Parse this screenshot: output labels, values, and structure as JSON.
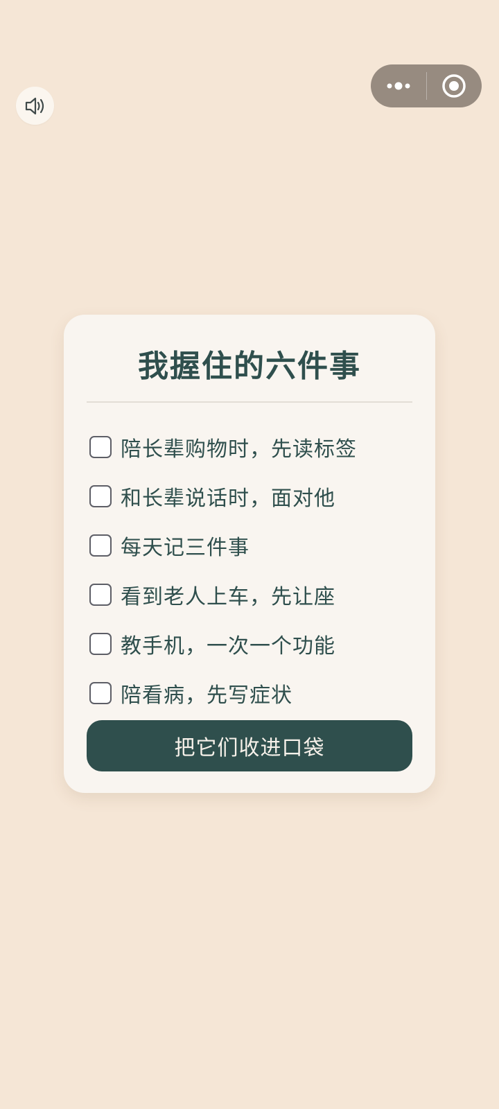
{
  "top_bar": {
    "sound_icon": "speaker-icon",
    "menu_icon": "more-dots-icon",
    "close_icon": "target-circle-icon"
  },
  "card": {
    "title": "我握住的六件事",
    "tasks": [
      {
        "label": "陪长辈购物时，先读标签",
        "checked": false
      },
      {
        "label": "和长辈说话时，面对他",
        "checked": false
      },
      {
        "label": "每天记三件事",
        "checked": false
      },
      {
        "label": "看到老人上车，先让座",
        "checked": false
      },
      {
        "label": "教手机，一次一个功能",
        "checked": false
      },
      {
        "label": "陪看病，先写症状",
        "checked": false
      }
    ],
    "button_label": "把它们收进口袋"
  },
  "colors": {
    "background": "#f5e6d6",
    "card": "#f9f5f0",
    "accent": "#2f4f4d",
    "capsule": "#978b80"
  }
}
